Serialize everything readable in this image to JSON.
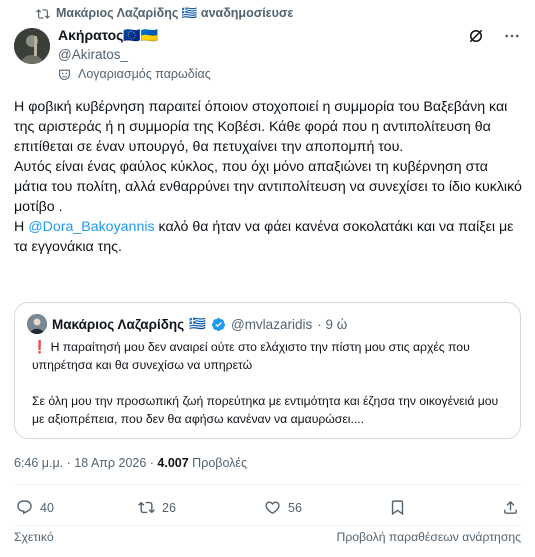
{
  "repost": {
    "text": "Μακάριος Λαζαρίδης 🇬🇷 αναδημοσίευσε"
  },
  "author": {
    "name": "Ακήρατος🇪🇺🇺🇦",
    "handle": "@Akiratos_"
  },
  "parody_label": "Λογαριασμός παρωδίας",
  "tweet": {
    "p1": "Η φοβική κυβέρνηση παραιτεί όποιον στοχοποιεί η συμμορία του Βαξεβάνη και της αριστεράς ή η συμμορία της Κοβέσι. Κάθε φορά που η αντιπολίτευση θα επιτίθεται σε έναν υπουργό, θα πετυχαίνει την αποπομπή του.",
    "p2": "Αυτός είναι ένας φαύλος κύκλος, που όχι μόνο απαξιώνει τη κυβέρνηση στα μάτια του πολίτη, αλλά ενθαρρύνει την αντιπολίτευση να συνεχίσει το ίδιο κυκλικό μοτίβο .",
    "p3_pre": "Η ",
    "mention": "@Dora_Bakoyannis",
    "p3_post": " καλό θα ήταν να φάει κανένα σοκολατάκι και να παίξει με τα εγγονάκια της."
  },
  "quote": {
    "name": "Μακάριος Λαζαρίδης",
    "flag": "🇬🇷",
    "handle": "@mvlazaridis",
    "time": "· 9 ώ",
    "line1_mark": "❗",
    "line1": "Η παραίτησή μου δεν αναιρεί ούτε στο ελάχιστο την πίστη μου στις αρχές που υπηρέτησα και θα συνεχίσω να υπηρετώ",
    "line2": "Σε όλη μου την προσωπική ζωή πορεύτηκα με εντιμότητα και έζησα την οικογένειά μου με αξιοπρέπεια, που δεν θα αφήσω κανέναν να αμαυρώσει...."
  },
  "meta": {
    "time_date": "6:46 μ.μ. · 18 Απρ 2026 · ",
    "views_count": "4.007",
    "views_label": " Προβολές"
  },
  "actions": {
    "replies": "40",
    "reposts": "26",
    "likes": "56"
  },
  "footer": {
    "related": "Σχετικό",
    "quotes_link": "Προβολή παραθέσεων ανάρτησης"
  },
  "colors": {
    "accent": "#1d9bf0",
    "muted": "#536471",
    "verified": "#1d9bf0"
  }
}
